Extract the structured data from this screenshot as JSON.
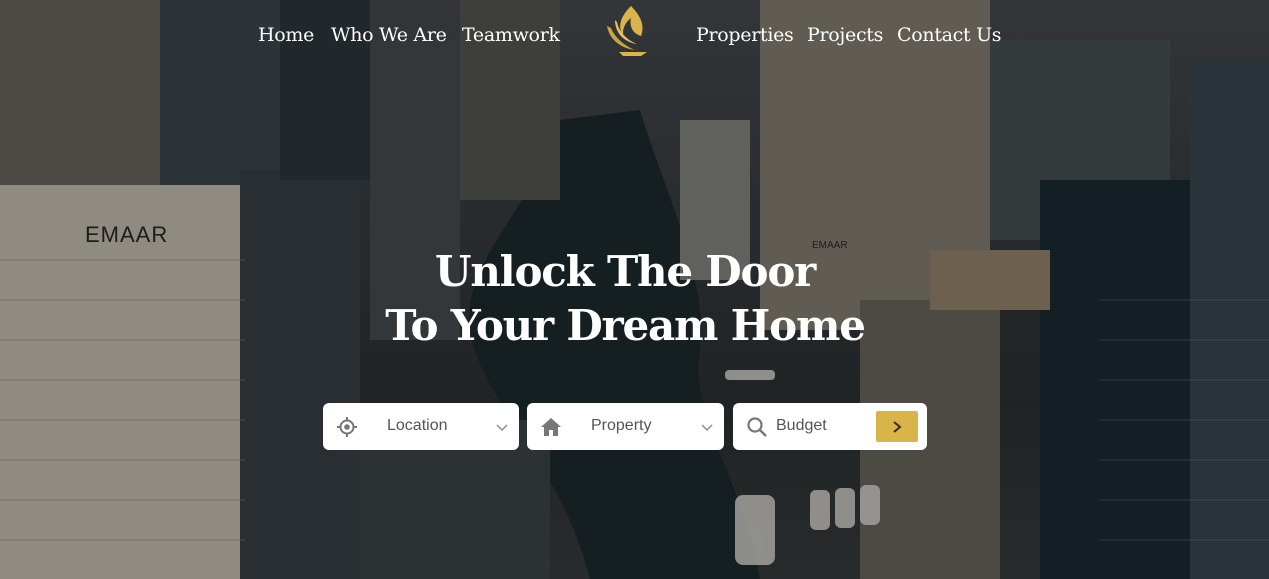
{
  "nav": {
    "left": [
      "Home",
      "Who We Are",
      "Teamwork"
    ],
    "right": [
      "Properties",
      "Projects",
      "Contact Us"
    ]
  },
  "hero": {
    "line1": "Unlock The Door",
    "line2": "To Your Dream Home"
  },
  "search": {
    "location": "Location",
    "property": "Property",
    "budget": "Budget"
  },
  "icons": [
    "location-icon",
    "home-icon",
    "search-icon",
    "chevron-down-icon",
    "chevron-right-icon",
    "flame-logo-icon"
  ],
  "colors": {
    "accent": "#d9b44a",
    "text": "#ffffff"
  }
}
